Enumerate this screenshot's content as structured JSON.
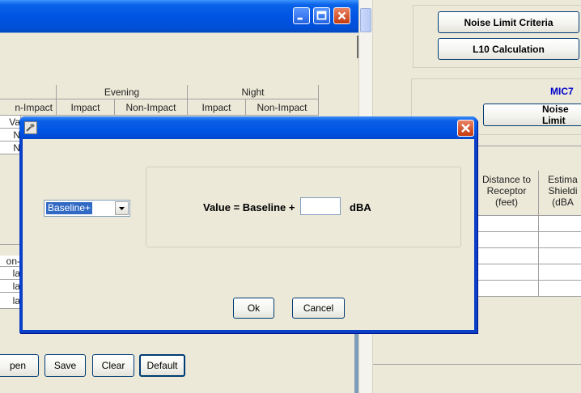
{
  "background_window": {
    "table": {
      "group_headers": [
        "Evening",
        "Night"
      ],
      "column_headers": [
        "n-Impact",
        "Impact",
        "Non-Impact",
        "Impact",
        "Non-Impact"
      ],
      "partial_left_cells": [
        "Va",
        "N",
        "N"
      ],
      "partial_left_cells_lower": [
        "on-",
        "la",
        "la",
        "la"
      ]
    },
    "buttons": {
      "open_partial": "pen",
      "save": "Save",
      "clear": "Clear",
      "default": "Default"
    }
  },
  "right_window": {
    "noise_limit_criteria": "Noise Limit Criteria",
    "l10_calculation": "L10 Calculation",
    "mic_label": "MIC7",
    "noise_limit_partial": "Noise Limit",
    "column_headers": [
      "Distance to Receptor (feet)",
      "Estima Shieldi (dBA"
    ],
    "colors": {
      "mic_label": "#0000cc"
    }
  },
  "dialog": {
    "selected_mode": "Baseline+",
    "formula_label": "Value = Baseline +",
    "value_input": "",
    "unit_label": "dBA",
    "ok_label": "Ok",
    "cancel_label": "Cancel",
    "icons": {
      "app": "hammer-icon",
      "close": "close-icon",
      "dropdown": "chevron-down-icon"
    }
  }
}
